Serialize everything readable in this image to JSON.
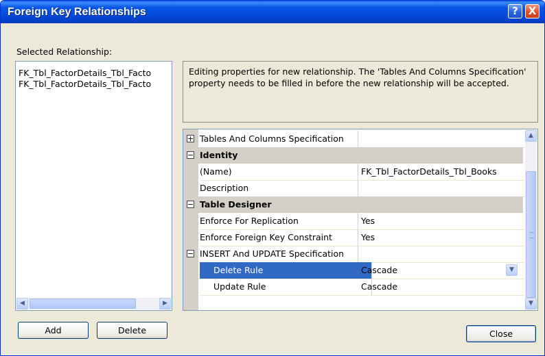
{
  "window": {
    "title": "Foreign Key Relationships",
    "help_glyph": "?",
    "close_glyph": "X"
  },
  "relationships": {
    "label": "Selected Relationship:",
    "items": [
      "FK_Tbl_FactorDetails_Tbl_Facto",
      "FK_Tbl_FactorDetails_Tbl_Facto"
    ]
  },
  "description": "Editing properties for new relationship.  The 'Tables And Columns Specification' property needs to be filled in before the new relationship will be accepted.",
  "properties": {
    "rows": [
      {
        "type": "expandable",
        "expander": "+",
        "name": "Tables And Columns Specification",
        "value": ""
      },
      {
        "type": "category",
        "expander": "−",
        "name": "Identity"
      },
      {
        "type": "prop",
        "name": "(Name)",
        "value": "FK_Tbl_FactorDetails_Tbl_Books"
      },
      {
        "type": "prop",
        "name": "Description",
        "value": ""
      },
      {
        "type": "category",
        "expander": "−",
        "name": "Table Designer"
      },
      {
        "type": "prop",
        "name": "Enforce For Replication",
        "value": "Yes"
      },
      {
        "type": "prop",
        "name": "Enforce Foreign Key Constraint",
        "value": "Yes"
      },
      {
        "type": "expandable",
        "expander": "−",
        "name": "INSERT And UPDATE Specification",
        "value": ""
      },
      {
        "type": "subprop",
        "name": "Delete Rule",
        "value": "Cascade",
        "selected": true
      },
      {
        "type": "subprop",
        "name": "Update Rule",
        "value": "Cascade"
      }
    ]
  },
  "buttons": {
    "add": "Add",
    "delete": "Delete",
    "close": "Close"
  },
  "colors": {
    "selection": "#316ac5",
    "category_bg": "#d4d0c8",
    "dialog_bg": "#ece9d8"
  }
}
